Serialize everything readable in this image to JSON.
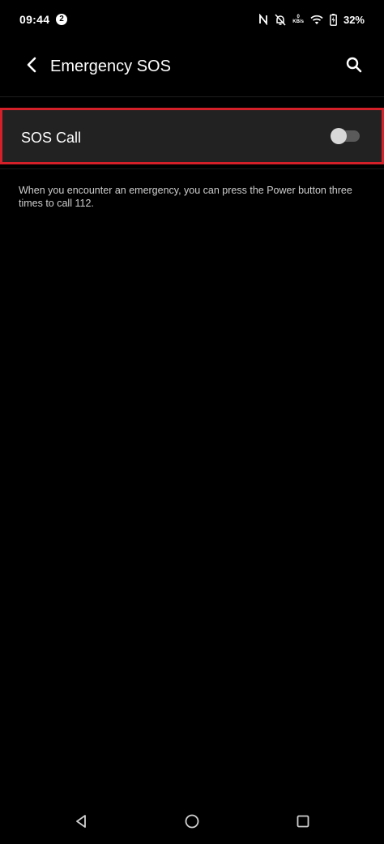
{
  "status_bar": {
    "time": "09:44",
    "notification_count": "2",
    "network_speed_value": "0",
    "network_speed_unit": "KB/s",
    "battery_percent": "32%"
  },
  "header": {
    "title": "Emergency SOS",
    "back_icon": "chevron-left-icon",
    "search_icon": "search-icon"
  },
  "settings": {
    "sos_call": {
      "label": "SOS Call",
      "enabled": false
    },
    "description": "When you encounter an emergency, you can press the Power button three times to call 112."
  },
  "colors": {
    "background": "#000000",
    "row_background": "#222222",
    "highlight_border": "#d32029",
    "toggle_track_off": "#5a5a5a",
    "toggle_thumb": "#d8d8d8",
    "secondary_text": "#cfcfcf"
  },
  "navigation_bar": {
    "buttons": [
      "back-triangle-icon",
      "home-circle-icon",
      "recents-square-icon"
    ]
  }
}
